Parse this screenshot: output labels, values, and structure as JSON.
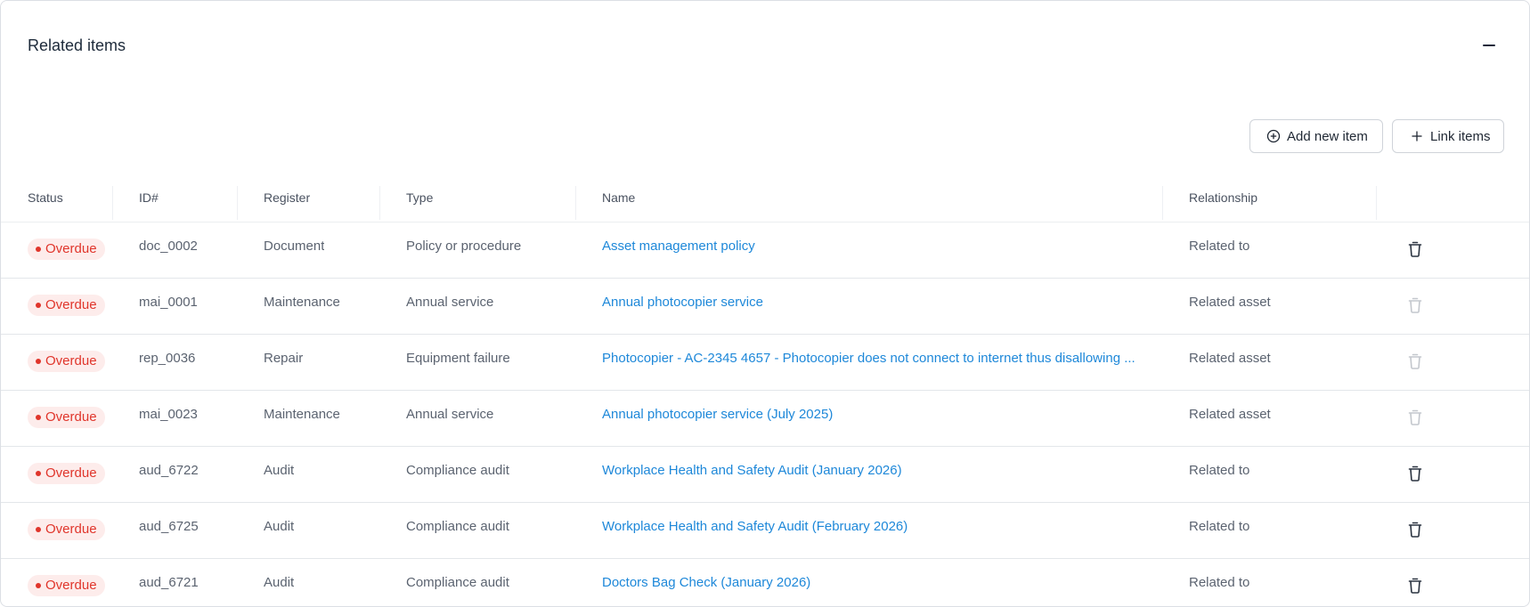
{
  "panel": {
    "title": "Related items"
  },
  "actions": {
    "add_new_label": "Add new item",
    "link_items_label": "Link items"
  },
  "table": {
    "columns": {
      "status": "Status",
      "id": "ID#",
      "register": "Register",
      "type": "Type",
      "name": "Name",
      "relationship": "Relationship"
    },
    "rows": [
      {
        "status": "Overdue",
        "id": "doc_0002",
        "register": "Document",
        "type": "Policy or procedure",
        "name": "Asset management policy",
        "relationship": "Related to",
        "delete_enabled": true
      },
      {
        "status": "Overdue",
        "id": "mai_0001",
        "register": "Maintenance",
        "type": "Annual service",
        "name": "Annual photocopier service",
        "relationship": "Related asset",
        "delete_enabled": false
      },
      {
        "status": "Overdue",
        "id": "rep_0036",
        "register": "Repair",
        "type": "Equipment failure",
        "name": "Photocopier - AC-2345 4657 - Photocopier does not connect to internet thus disallowing ...",
        "relationship": "Related asset",
        "delete_enabled": false
      },
      {
        "status": "Overdue",
        "id": "mai_0023",
        "register": "Maintenance",
        "type": "Annual service",
        "name": "Annual photocopier service (July 2025)",
        "relationship": "Related asset",
        "delete_enabled": false
      },
      {
        "status": "Overdue",
        "id": "aud_6722",
        "register": "Audit",
        "type": "Compliance audit",
        "name": "Workplace Health and Safety Audit (January 2026)",
        "relationship": "Related to",
        "delete_enabled": true
      },
      {
        "status": "Overdue",
        "id": "aud_6725",
        "register": "Audit",
        "type": "Compliance audit",
        "name": "Workplace Health and Safety Audit (February 2026)",
        "relationship": "Related to",
        "delete_enabled": true
      },
      {
        "status": "Overdue",
        "id": "aud_6721",
        "register": "Audit",
        "type": "Compliance audit",
        "name": "Doctors Bag Check (January 2026)",
        "relationship": "Related to",
        "delete_enabled": true
      }
    ]
  },
  "colors": {
    "link": "#1e88d9",
    "overdue_text": "#e0352b",
    "overdue_bg": "#fdeceb",
    "title": "#1d2a3a"
  },
  "icons": {
    "collapse": "minus-icon",
    "add": "plus-circle-icon",
    "link": "plus-icon",
    "delete": "trash-icon"
  }
}
